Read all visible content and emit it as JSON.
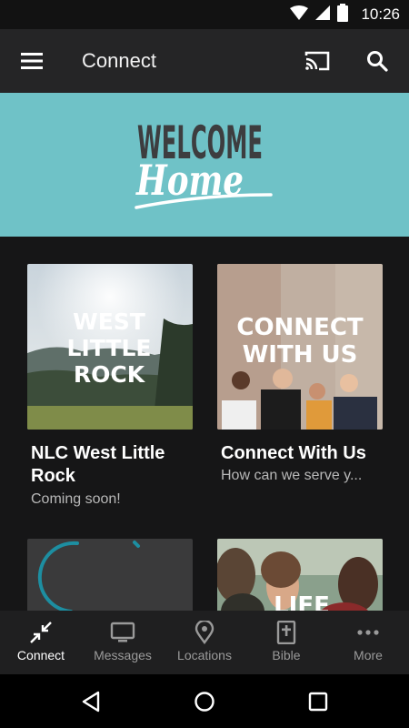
{
  "status": {
    "time": "10:26"
  },
  "app_bar": {
    "title": "Connect"
  },
  "hero": {
    "line1": "WELCOME",
    "line2": "Home"
  },
  "cards": [
    {
      "title": "NLC West Little Rock",
      "subtitle": "Coming soon!",
      "image_text": [
        "WEST",
        "LITTLE",
        "ROCK"
      ]
    },
    {
      "title": "Connect With Us",
      "subtitle": "How can we serve y...",
      "image_text": [
        "CONNECT",
        "WITH US"
      ]
    },
    {
      "title": "",
      "subtitle": ""
    },
    {
      "title": "",
      "subtitle": "",
      "image_text": [
        "LIFE"
      ]
    }
  ],
  "bottom_nav": [
    {
      "label": "Connect",
      "icon": "connect-icon",
      "active": true
    },
    {
      "label": "Messages",
      "icon": "tv-icon",
      "active": false
    },
    {
      "label": "Locations",
      "icon": "location-pin-icon",
      "active": false
    },
    {
      "label": "Bible",
      "icon": "bible-icon",
      "active": false
    },
    {
      "label": "More",
      "icon": "more-dots-icon",
      "active": false
    }
  ],
  "colors": {
    "hero_bg": "#6fc2c7",
    "app_bar": "#252526",
    "background": "#161617",
    "nav_bg": "#1f1f20"
  }
}
